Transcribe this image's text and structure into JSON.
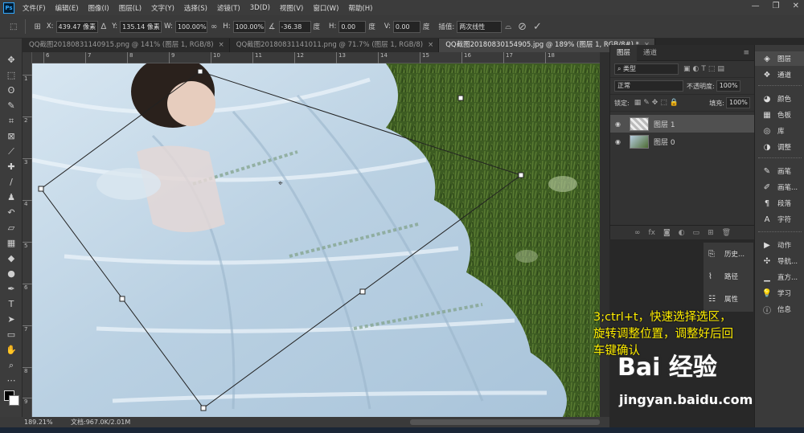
{
  "app": {
    "logo": "Ps"
  },
  "menu": [
    "文件(F)",
    "编辑(E)",
    "图像(I)",
    "图层(L)",
    "文字(Y)",
    "选择(S)",
    "滤镜(T)",
    "3D(D)",
    "视图(V)",
    "窗口(W)",
    "帮助(H)"
  ],
  "window_controls": [
    "—",
    "❐",
    "✕"
  ],
  "options": {
    "x_label": "X:",
    "x_value": "439.47 像素",
    "y_label": "Y:",
    "y_value": "135.14 像素",
    "w_label": "W:",
    "w_value": "100.00%",
    "h_label": "H:",
    "h_value": "100.00%",
    "angle_value": "-36.38",
    "angle_unit": "度",
    "hskew_label": "H:",
    "hskew_value": "0.00",
    "hskew_unit": "度",
    "vskew_label": "V:",
    "vskew_value": "0.00",
    "vskew_unit": "度",
    "interp_label": "插值:",
    "interp_value": "两次线性",
    "cancel_icon": "⊘",
    "commit_icon": "✓"
  },
  "tabs": [
    {
      "label": "QQ截图20180831140915.png @ 141% (图层 1, RGB/8)",
      "close": "×",
      "active": false
    },
    {
      "label": "QQ截图20180831141011.png @ 71.7% (图层 1, RGB/8)",
      "close": "×",
      "active": false
    },
    {
      "label": "QQ截图20180830154905.jpg @ 189% (图层 1, RGB/8#) *",
      "close": "×",
      "active": true
    }
  ],
  "ruler_top": [
    "6",
    "7",
    "8",
    "9",
    "10",
    "11",
    "12",
    "13",
    "14",
    "15",
    "16",
    "17",
    "18"
  ],
  "ruler_left": [
    "1",
    "2",
    "3",
    "4",
    "5",
    "6",
    "7",
    "8",
    "9"
  ],
  "status": {
    "zoom": "189.21%",
    "doc": "文档:967.0K/2.01M"
  },
  "layers_panel": {
    "tabs": [
      "图层",
      "通道"
    ],
    "kind_label": "类型",
    "blend_mode": "正常",
    "opacity_label": "不透明度:",
    "opacity_value": "100%",
    "lock_label": "锁定:",
    "fill_label": "填充:",
    "fill_value": "100%",
    "layers": [
      {
        "name": "图层 1",
        "selected": true
      },
      {
        "name": "图层 0",
        "selected": false
      }
    ]
  },
  "mini_panel": [
    {
      "icon": "history-icon",
      "label": "历史..."
    },
    {
      "icon": "path-icon",
      "label": "路径"
    },
    {
      "icon": "properties-icon",
      "label": "属性"
    }
  ],
  "dock": [
    {
      "icon": "layers-icon",
      "label": "图层"
    },
    {
      "icon": "channels-icon",
      "label": "通道"
    },
    {
      "icon": "color-icon",
      "label": "颜色"
    },
    {
      "icon": "swatches-icon",
      "label": "色板"
    },
    {
      "icon": "library-icon",
      "label": "库"
    },
    {
      "icon": "adjust-icon",
      "label": "调整"
    },
    {
      "icon": "brush-icon",
      "label": "画笔"
    },
    {
      "icon": "brush-preset-icon",
      "label": "画笔..."
    },
    {
      "icon": "paragraph-icon",
      "label": "段落"
    },
    {
      "icon": "character-icon",
      "label": "字符"
    },
    {
      "icon": "actions-icon",
      "label": "动作"
    },
    {
      "icon": "navigator-icon",
      "label": "导航..."
    },
    {
      "icon": "histogram-icon",
      "label": "直方..."
    },
    {
      "icon": "learn-icon",
      "label": "学习"
    },
    {
      "icon": "info-icon",
      "label": "信息"
    }
  ],
  "annotation": {
    "line1": "3;ctrl+t，快速选择选区，",
    "line2": "旋转调整位置，调整好后回",
    "line3": "车键确认"
  },
  "watermark": {
    "logo": "Bai 经验",
    "url": "jingyan.baidu.com"
  },
  "colors": {
    "annotation": "#ffee00",
    "accent": "#31a8ff",
    "grass": "#3b5a24",
    "dress": "#c9dcea"
  }
}
